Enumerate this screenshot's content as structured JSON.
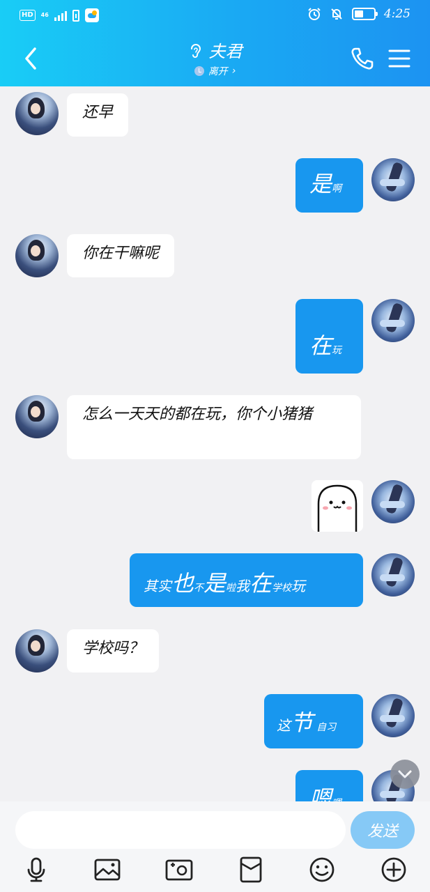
{
  "status_bar": {
    "hd": "HD",
    "network": "46",
    "time": "4:25"
  },
  "header": {
    "contact_name": "夫君",
    "presence": "离开",
    "presence_chevron": "›"
  },
  "messages": [
    {
      "from": "them",
      "text": "还早"
    },
    {
      "from": "me",
      "parts": [
        {
          "t": "是",
          "size": "big"
        },
        {
          "t": "啊",
          "size": "sml"
        }
      ]
    },
    {
      "from": "them",
      "text": "你在干嘛呢"
    },
    {
      "from": "me",
      "parts": [
        {
          "t": "在",
          "size": "big"
        },
        {
          "t": "玩",
          "size": "sml"
        }
      ]
    },
    {
      "from": "them",
      "text": "怎么一天天的都在玩，你个小猪猪"
    },
    {
      "from": "me",
      "type": "sticker",
      "icon": "smiley-sticker"
    },
    {
      "from": "me",
      "parts": [
        {
          "t": "其实",
          "size": "med"
        },
        {
          "t": "也",
          "size": "big"
        },
        {
          "t": "不",
          "size": "sml"
        },
        {
          "t": "是",
          "size": "big"
        },
        {
          "t": "啦",
          "size": "sml"
        },
        {
          "t": "我",
          "size": "med"
        },
        {
          "t": "在",
          "size": "big"
        },
        {
          "t": "学校",
          "size": "sml"
        },
        {
          "t": "玩",
          "size": "med"
        }
      ]
    },
    {
      "from": "them",
      "text": "学校吗？"
    },
    {
      "from": "me",
      "parts": [
        {
          "t": "这",
          "size": "med"
        },
        {
          "t": "节",
          "size": "big"
        },
        {
          "t": "自习",
          "size": "sml"
        }
      ]
    },
    {
      "from": "me",
      "parts": [
        {
          "t": "嗯",
          "size": "big"
        },
        {
          "t": "嗯",
          "size": "sml"
        }
      ]
    }
  ],
  "input": {
    "placeholder": "",
    "send_label": "发送"
  },
  "toolbar": {
    "icons": [
      "microphone-icon",
      "image-icon",
      "camera-icon",
      "red-packet-icon",
      "emoji-icon",
      "plus-icon"
    ]
  },
  "colors": {
    "header_start": "#19cdf6",
    "header_end": "#1c93f2",
    "outgoing_bubble": "#1897ef",
    "incoming_bubble": "#ffffff",
    "chat_bg": "#f1f1f3",
    "send_button": "#86c9f6"
  }
}
